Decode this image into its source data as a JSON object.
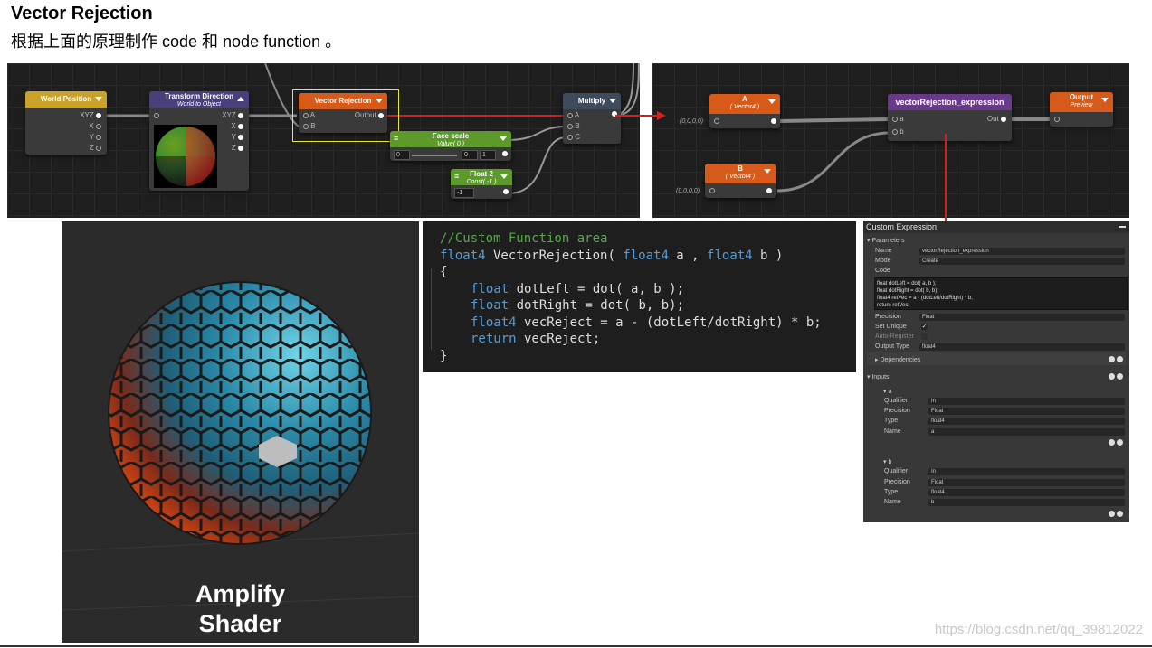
{
  "slide": {
    "title": "Vector Rejection",
    "subtitle": "根据上面的原理制作 code  和 node function 。",
    "watermark": "https://blog.csdn.net/qq_39812022"
  },
  "graph1": {
    "world_position": {
      "title": "World Position",
      "out_xyz": "XYZ",
      "out_x": "X",
      "out_y": "Y",
      "out_z": "Z"
    },
    "transform_direction": {
      "title": "Transform Direction",
      "subtitle": "World to Object",
      "out_xyz": "XYZ",
      "out_x": "X",
      "out_y": "Y",
      "out_z": "Z"
    },
    "vector_rejection": {
      "title": "Vector Rejection",
      "in_a": "A",
      "in_b": "B",
      "output": "Output"
    },
    "face_scale": {
      "title": "Face scale",
      "subtitle": "Value( 0 )",
      "min": "0",
      "val": "0",
      "max": "1"
    },
    "float2": {
      "title": "Float 2",
      "subtitle": "Const( -1 )",
      "value": "-1"
    },
    "multiply": {
      "title": "Multiply",
      "in_a": "A",
      "in_b": "B",
      "in_c": "C"
    }
  },
  "graph2": {
    "a_node": {
      "title": "A",
      "subtitle": "( Vector4 )",
      "default": "(0,0,0,0)"
    },
    "b_node": {
      "title": "B",
      "subtitle": "( Vector4 )",
      "default": "(0,0,0,0)"
    },
    "expr_node": {
      "title": "vectorRejection_expression",
      "in_a": "a",
      "in_b": "b",
      "out": "Out"
    },
    "output_node": {
      "title": "Output",
      "subtitle": "Preview"
    }
  },
  "code": {
    "lines": [
      "//Custom Function area",
      "float4 VectorRejection( float4 a , float4 b )",
      "{",
      "    float dotLeft = dot( a, b );",
      "    float dotRight = dot( b, b);",
      "    float4 vecReject = a - (dotLeft/dotRight) * b;",
      "    return vecReject;",
      "}"
    ],
    "l1_kw": "float4",
    "l1_name": " VectorRejection( ",
    "l1_kw2": "float4",
    "l1_a": " a , ",
    "l1_kw3": "float4",
    "l1_b": " b )",
    "l3_kw": "float",
    "l3_rest": " dotLeft = dot( a, b );",
    "l4_kw": "float",
    "l4_rest": " dotRight = dot( b, b);",
    "l5_kw": "float4",
    "l5_rest": " vecReject = a - (dotLeft/dotRight) * b;",
    "l6_kw": "return",
    "l6_rest": " vecReject;"
  },
  "inspector": {
    "title": "Custom Expression",
    "parameters": "Parameters",
    "name_label": "Name",
    "name_value": "vectorRejection_expression",
    "mode_label": "Mode",
    "mode_value": "Create",
    "code_label": "Code",
    "code_lines": [
      "float dotLeft = dot( a, b );",
      "float dotRight = dot( b, b);",
      "float4 retVec = a - (dotLeft/dotRight) * b;",
      "return retVec;"
    ],
    "precision_label": "Precision",
    "precision_value": "Float",
    "set_unique_label": "Set Unique",
    "auto_register_label": "Auto-Register",
    "output_type_label": "Output Type",
    "output_type_value": "float4",
    "dependencies": "Dependencies",
    "inputs": "Inputs",
    "in_a": {
      "header": "a",
      "qualifier": "In",
      "precision": "Float",
      "type": "float4",
      "name": "a"
    },
    "in_b": {
      "header": "b",
      "qualifier": "In",
      "precision": "Float",
      "type": "float4",
      "name": "b"
    },
    "qualifier_label": "Qualifier",
    "prec_label": "Precision",
    "type_label": "Type",
    "nm_label": "Name"
  },
  "render": {
    "line1": "Amplify",
    "line2": "Shader"
  },
  "colors": {
    "accent_red": "#d91e1e",
    "world_pos": "#c9a227",
    "transform": "#4a3f7a",
    "rejection": "#d65a1a",
    "float_green": "#5c9a2a",
    "multiply": "#3d4b5c"
  }
}
